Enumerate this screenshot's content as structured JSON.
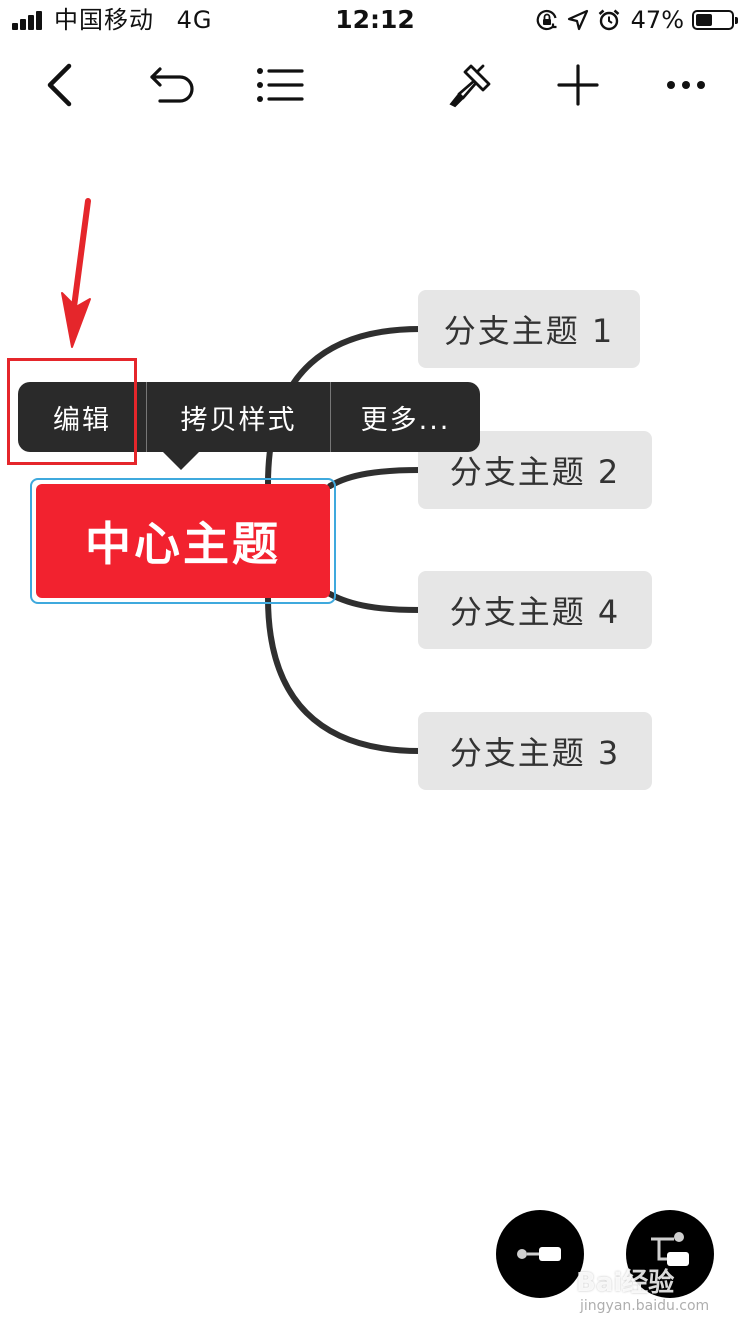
{
  "status_bar": {
    "carrier": "中国移动",
    "network": "4G",
    "time": "12:12",
    "battery_percent": "47%",
    "battery_level": 0.47,
    "icons": [
      "signal-icon",
      "orientation-lock-icon",
      "location-icon",
      "alarm-icon",
      "battery-icon"
    ]
  },
  "toolbar": {
    "icons": [
      "back-icon",
      "undo-icon",
      "outline-list-icon",
      "format-brush-icon",
      "add-icon",
      "more-icon"
    ]
  },
  "mindmap": {
    "central_topic": "中心主题",
    "branches": [
      {
        "label": "分支主题 1"
      },
      {
        "label": "分支主题 2"
      },
      {
        "label": "分支主题 4"
      },
      {
        "label": "分支主题 3"
      }
    ]
  },
  "context_menu": {
    "items": [
      {
        "label": "编辑"
      },
      {
        "label": "拷贝样式"
      },
      {
        "label": "更多..."
      }
    ]
  },
  "bottom_actions": {
    "icons": [
      "add-subtopic-icon",
      "add-sibling-topic-icon"
    ]
  },
  "watermark": {
    "logo": "Bai经验",
    "url": "jingyan.baidu.com"
  },
  "colors": {
    "central_topic": "#f2222f",
    "selection_border": "#3fa9dd",
    "branch_background": "#e6e6e6",
    "context_menu_background": "#2a2a2a",
    "annotation": "#e5262b"
  }
}
